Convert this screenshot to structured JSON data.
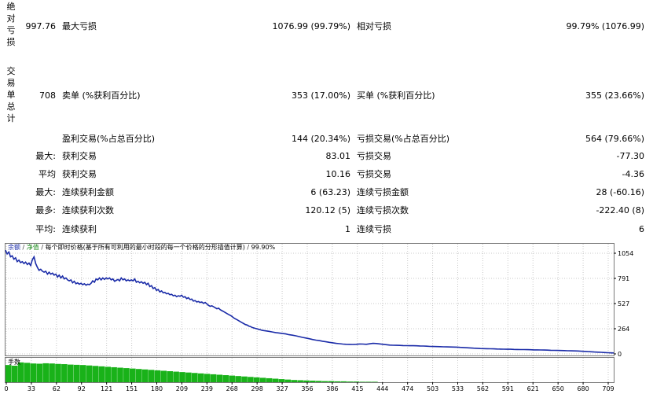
{
  "stats": {
    "abs_group_label": [
      "绝",
      "对",
      "亏",
      "损"
    ],
    "trade_group_label": [
      "交",
      "易",
      "单",
      "总",
      "计"
    ],
    "abs_value": "997.76",
    "max_drawdown_label": "最大亏损",
    "max_drawdown_value": "1076.99 (99.79%)",
    "rel_drawdown_label": "相对亏损",
    "rel_drawdown_value": "99.79% (1076.99)",
    "total_trades": "708",
    "short_label": "卖单 (%获利百分比)",
    "short_value": "353 (17.00%)",
    "long_label": "买单 (%获利百分比)",
    "long_value": "355 (23.66%)",
    "profit_trades_label": "盈利交易(%占总百分比)",
    "profit_trades_value": "144 (20.34%)",
    "loss_trades_label": "亏损交易(%占总百分比)",
    "loss_trades_value": "564 (79.66%)",
    "rows": [
      {
        "prefix": "最大:",
        "label": "获利交易",
        "value": "83.01",
        "label2": "亏损交易",
        "value2": "-77.30"
      },
      {
        "prefix": "平均",
        "label": "获利交易",
        "value": "10.16",
        "label2": "亏损交易",
        "value2": "-4.36"
      },
      {
        "prefix": "最大:",
        "label": "连续获利金额",
        "value": "6 (63.23)",
        "label2": "连续亏损金额",
        "value2": "28 (-60.16)"
      },
      {
        "prefix": "最多:",
        "label": "连续获利次数",
        "value": "120.12 (5)",
        "label2": "连续亏损次数",
        "value2": "-222.40 (8)"
      },
      {
        "prefix": "平均:",
        "label": "连续获利",
        "value": "1",
        "label2": "连续亏损",
        "value2": "6"
      }
    ]
  },
  "chart_legend": {
    "series1": "余额",
    "series2": "净值",
    "description": "每个即时价格(基于所有可利用的最小时段的每一个价格的分形插值计算)",
    "percent": "99.90%",
    "volume_label": "手数"
  },
  "colors": {
    "balance_line": "#1a2ba8",
    "volume_bar": "#19b219",
    "grid": "#c8c8c8"
  },
  "chart_data": {
    "type": "line",
    "title": "",
    "xlabel": "",
    "ylabel": "",
    "x_ticks": [
      "0",
      "33",
      "62",
      "92",
      "121",
      "151",
      "180",
      "209",
      "239",
      "268",
      "298",
      "327",
      "356",
      "386",
      "415",
      "444",
      "474",
      "503",
      "533",
      "562",
      "591",
      "621",
      "650",
      "680",
      "709"
    ],
    "y_ticks": [
      "1054",
      "791",
      "527",
      "264",
      "0"
    ],
    "ylim": [
      0,
      1080
    ],
    "xlim": [
      0,
      725
    ],
    "series": [
      {
        "name": "余额",
        "points": [
          [
            0,
            1078
          ],
          [
            2,
            1040
          ],
          [
            4,
            1060
          ],
          [
            6,
            1010
          ],
          [
            8,
            1020
          ],
          [
            10,
            985
          ],
          [
            12,
            1000
          ],
          [
            14,
            960
          ],
          [
            16,
            975
          ],
          [
            18,
            950
          ],
          [
            20,
            960
          ],
          [
            22,
            940
          ],
          [
            24,
            955
          ],
          [
            26,
            930
          ],
          [
            28,
            945
          ],
          [
            30,
            920
          ],
          [
            32,
            980
          ],
          [
            34,
            1010
          ],
          [
            36,
            940
          ],
          [
            38,
            900
          ],
          [
            40,
            870
          ],
          [
            42,
            880
          ],
          [
            44,
            860
          ],
          [
            46,
            850
          ],
          [
            48,
            860
          ],
          [
            50,
            830
          ],
          [
            52,
            850
          ],
          [
            54,
            830
          ],
          [
            56,
            840
          ],
          [
            58,
            820
          ],
          [
            60,
            830
          ],
          [
            62,
            800
          ],
          [
            64,
            820
          ],
          [
            66,
            790
          ],
          [
            68,
            810
          ],
          [
            70,
            780
          ],
          [
            72,
            790
          ],
          [
            74,
            770
          ],
          [
            76,
            760
          ],
          [
            78,
            770
          ],
          [
            80,
            740
          ],
          [
            82,
            755
          ],
          [
            84,
            730
          ],
          [
            86,
            740
          ],
          [
            88,
            725
          ],
          [
            90,
            735
          ],
          [
            92,
            720
          ],
          [
            94,
            730
          ],
          [
            96,
            715
          ],
          [
            98,
            725
          ],
          [
            100,
            720
          ],
          [
            102,
            735
          ],
          [
            104,
            760
          ],
          [
            106,
            745
          ],
          [
            108,
            780
          ],
          [
            110,
            770
          ],
          [
            112,
            790
          ],
          [
            114,
            770
          ],
          [
            116,
            790
          ],
          [
            118,
            775
          ],
          [
            120,
            790
          ],
          [
            122,
            780
          ],
          [
            124,
            790
          ],
          [
            126,
            770
          ],
          [
            128,
            780
          ],
          [
            130,
            755
          ],
          [
            132,
            765
          ],
          [
            134,
            775
          ],
          [
            136,
            760
          ],
          [
            138,
            790
          ],
          [
            140,
            770
          ],
          [
            142,
            780
          ],
          [
            144,
            760
          ],
          [
            146,
            770
          ],
          [
            148,
            760
          ],
          [
            150,
            770
          ],
          [
            152,
            760
          ],
          [
            154,
            780
          ],
          [
            156,
            745
          ],
          [
            158,
            755
          ],
          [
            160,
            740
          ],
          [
            162,
            750
          ],
          [
            164,
            735
          ],
          [
            166,
            745
          ],
          [
            168,
            720
          ],
          [
            170,
            735
          ],
          [
            172,
            700
          ],
          [
            174,
            710
          ],
          [
            176,
            680
          ],
          [
            178,
            690
          ],
          [
            180,
            660
          ],
          [
            182,
            670
          ],
          [
            184,
            645
          ],
          [
            186,
            655
          ],
          [
            188,
            635
          ],
          [
            190,
            640
          ],
          [
            192,
            625
          ],
          [
            194,
            630
          ],
          [
            196,
            615
          ],
          [
            198,
            620
          ],
          [
            200,
            605
          ],
          [
            202,
            610
          ],
          [
            204,
            595
          ],
          [
            206,
            605
          ],
          [
            208,
            600
          ],
          [
            210,
            610
          ],
          [
            212,
            590
          ],
          [
            214,
            595
          ],
          [
            216,
            575
          ],
          [
            218,
            585
          ],
          [
            220,
            565
          ],
          [
            222,
            570
          ],
          [
            224,
            550
          ],
          [
            226,
            555
          ],
          [
            228,
            540
          ],
          [
            230,
            545
          ],
          [
            232,
            535
          ],
          [
            234,
            540
          ],
          [
            236,
            525
          ],
          [
            238,
            535
          ],
          [
            240,
            520
          ],
          [
            242,
            505
          ],
          [
            244,
            495
          ],
          [
            246,
            500
          ],
          [
            248,
            490
          ],
          [
            250,
            480
          ],
          [
            252,
            470
          ],
          [
            254,
            475
          ],
          [
            256,
            460
          ],
          [
            258,
            450
          ],
          [
            260,
            440
          ],
          [
            262,
            430
          ],
          [
            264,
            420
          ],
          [
            266,
            410
          ],
          [
            268,
            400
          ],
          [
            270,
            390
          ],
          [
            272,
            375
          ],
          [
            274,
            365
          ],
          [
            276,
            355
          ],
          [
            278,
            345
          ],
          [
            280,
            335
          ],
          [
            282,
            325
          ],
          [
            284,
            315
          ],
          [
            286,
            305
          ],
          [
            288,
            300
          ],
          [
            290,
            290
          ],
          [
            292,
            285
          ],
          [
            294,
            275
          ],
          [
            296,
            270
          ],
          [
            298,
            265
          ],
          [
            300,
            260
          ],
          [
            302,
            255
          ],
          [
            304,
            250
          ],
          [
            306,
            245
          ],
          [
            310,
            240
          ],
          [
            314,
            235
          ],
          [
            318,
            228
          ],
          [
            322,
            222
          ],
          [
            326,
            218
          ],
          [
            330,
            212
          ],
          [
            334,
            208
          ],
          [
            338,
            200
          ],
          [
            342,
            195
          ],
          [
            346,
            188
          ],
          [
            350,
            180
          ],
          [
            354,
            172
          ],
          [
            358,
            165
          ],
          [
            362,
            158
          ],
          [
            366,
            150
          ],
          [
            370,
            143
          ],
          [
            374,
            138
          ],
          [
            378,
            132
          ],
          [
            382,
            126
          ],
          [
            386,
            120
          ],
          [
            390,
            115
          ],
          [
            394,
            110
          ],
          [
            398,
            106
          ],
          [
            402,
            102
          ],
          [
            406,
            100
          ],
          [
            410,
            99
          ],
          [
            414,
            98
          ],
          [
            418,
            100
          ],
          [
            422,
            103
          ],
          [
            426,
            102
          ],
          [
            430,
            100
          ],
          [
            434,
            105
          ],
          [
            438,
            110
          ],
          [
            442,
            108
          ],
          [
            446,
            104
          ],
          [
            450,
            100
          ],
          [
            454,
            96
          ],
          [
            458,
            92
          ],
          [
            462,
            90
          ],
          [
            466,
            89
          ],
          [
            470,
            88
          ],
          [
            474,
            87
          ],
          [
            478,
            86
          ],
          [
            482,
            85
          ],
          [
            486,
            85
          ],
          [
            490,
            84
          ],
          [
            494,
            83
          ],
          [
            498,
            82
          ],
          [
            502,
            80
          ],
          [
            506,
            78
          ],
          [
            510,
            77
          ],
          [
            514,
            76
          ],
          [
            518,
            75
          ],
          [
            522,
            74
          ],
          [
            526,
            73
          ],
          [
            530,
            72
          ],
          [
            534,
            71
          ],
          [
            538,
            70
          ],
          [
            542,
            68
          ],
          [
            546,
            66
          ],
          [
            550,
            64
          ],
          [
            554,
            62
          ],
          [
            558,
            60
          ],
          [
            562,
            58
          ],
          [
            566,
            56
          ],
          [
            570,
            55
          ],
          [
            574,
            54
          ],
          [
            578,
            53
          ],
          [
            582,
            52
          ],
          [
            586,
            51
          ],
          [
            590,
            50
          ],
          [
            594,
            49
          ],
          [
            598,
            48
          ],
          [
            602,
            48
          ],
          [
            606,
            47
          ],
          [
            610,
            46
          ],
          [
            614,
            45
          ],
          [
            618,
            45
          ],
          [
            622,
            44
          ],
          [
            626,
            43
          ],
          [
            630,
            42
          ],
          [
            634,
            42
          ],
          [
            638,
            41
          ],
          [
            642,
            40
          ],
          [
            646,
            39
          ],
          [
            650,
            38
          ],
          [
            654,
            37
          ],
          [
            658,
            36
          ],
          [
            662,
            35
          ],
          [
            666,
            34
          ],
          [
            670,
            33
          ],
          [
            674,
            32
          ],
          [
            678,
            31
          ],
          [
            682,
            30
          ],
          [
            686,
            28
          ],
          [
            690,
            26
          ],
          [
            694,
            24
          ],
          [
            698,
            22
          ],
          [
            702,
            20
          ],
          [
            706,
            18
          ],
          [
            710,
            16
          ],
          [
            714,
            14
          ],
          [
            718,
            12
          ],
          [
            722,
            11
          ],
          [
            725,
            10
          ]
        ]
      }
    ],
    "volume": {
      "name": "手数",
      "xlim": [
        0,
        725
      ],
      "max": 1.0,
      "values": [
        0.78,
        0.75,
        0.9,
        0.88,
        0.85,
        0.84,
        0.86,
        0.85,
        0.83,
        0.82,
        0.8,
        0.79,
        0.78,
        0.76,
        0.74,
        0.72,
        0.7,
        0.68,
        0.66,
        0.64,
        0.62,
        0.6,
        0.58,
        0.56,
        0.54,
        0.52,
        0.5,
        0.48,
        0.46,
        0.44,
        0.42,
        0.4,
        0.38,
        0.36,
        0.34,
        0.32,
        0.3,
        0.28,
        0.26,
        0.24,
        0.22,
        0.2,
        0.18,
        0.16,
        0.14,
        0.12,
        0.1,
        0.09,
        0.08,
        0.07,
        0.06,
        0.05,
        0.05,
        0.04,
        0.04,
        0.03,
        0.03,
        0.02,
        0.02,
        0.02
      ]
    }
  }
}
